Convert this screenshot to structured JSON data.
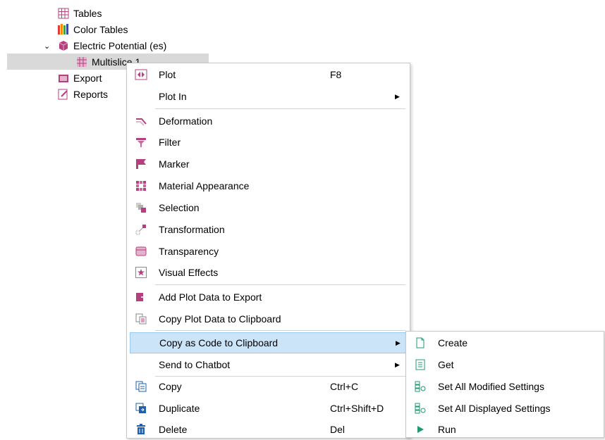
{
  "tree": {
    "items": [
      {
        "label": "Tables"
      },
      {
        "label": "Color Tables"
      },
      {
        "label": "Electric Potential (es)"
      },
      {
        "label": "Multislice 1"
      },
      {
        "label": "Export"
      },
      {
        "label": "Reports"
      }
    ]
  },
  "context_menu": {
    "items": [
      {
        "label": "Plot",
        "shortcut": "F8"
      },
      {
        "label": "Plot In"
      },
      {
        "label": "Deformation"
      },
      {
        "label": "Filter"
      },
      {
        "label": "Marker"
      },
      {
        "label": "Material Appearance"
      },
      {
        "label": "Selection"
      },
      {
        "label": "Transformation"
      },
      {
        "label": "Transparency"
      },
      {
        "label": "Visual Effects"
      },
      {
        "label": "Add Plot Data to Export"
      },
      {
        "label": "Copy Plot Data to Clipboard"
      },
      {
        "label": "Copy as Code to Clipboard"
      },
      {
        "label": "Send to Chatbot"
      },
      {
        "label": "Copy",
        "shortcut": "Ctrl+C"
      },
      {
        "label": "Duplicate",
        "shortcut": "Ctrl+Shift+D"
      },
      {
        "label": "Delete",
        "shortcut": "Del"
      }
    ]
  },
  "submenu": {
    "items": [
      {
        "label": "Create"
      },
      {
        "label": "Get"
      },
      {
        "label": "Set All Modified Settings"
      },
      {
        "label": "Set All Displayed Settings"
      },
      {
        "label": "Run"
      }
    ]
  },
  "colors": {
    "accent": "#b5407e",
    "highlight": "#cce4f7",
    "run_green": "#1d9b6c"
  }
}
